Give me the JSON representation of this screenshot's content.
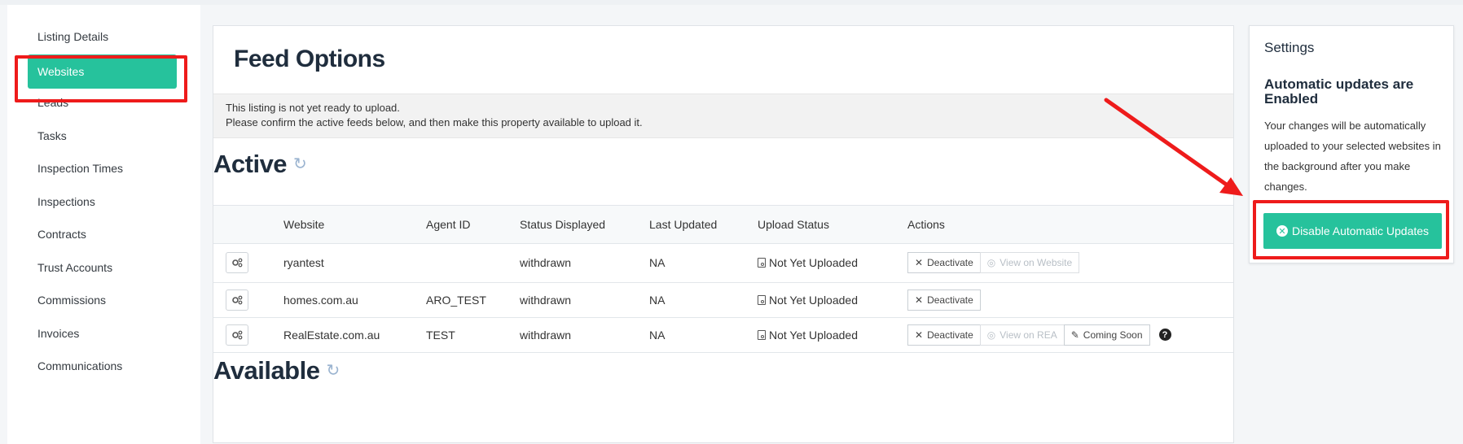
{
  "sidebar": {
    "items": [
      {
        "label": "Listing Details"
      },
      {
        "label": "Websites"
      },
      {
        "label": "Leads"
      },
      {
        "label": "Tasks"
      },
      {
        "label": "Inspection Times"
      },
      {
        "label": "Inspections"
      },
      {
        "label": "Contracts"
      },
      {
        "label": "Trust Accounts"
      },
      {
        "label": "Commissions"
      },
      {
        "label": "Invoices"
      },
      {
        "label": "Communications"
      }
    ],
    "active": "Websites"
  },
  "main": {
    "title": "Feed Options",
    "notice_line1": "This listing is not yet ready to upload.",
    "notice_line2": "Please confirm the active feeds below, and then make this property available to upload it.",
    "active_title": "Active",
    "available_title": "Available",
    "table": {
      "headers": [
        "Website",
        "Agent ID",
        "Status Displayed",
        "Last Updated",
        "Upload Status",
        "Actions"
      ],
      "rows": [
        {
          "website": "ryantest",
          "agent_id": "",
          "status": "withdrawn",
          "last_updated": "NA",
          "upload_status": "Not Yet Uploaded",
          "actions": {
            "deactivate": "Deactivate",
            "view": "View on Website"
          }
        },
        {
          "website": "homes.com.au",
          "agent_id": "ARO_TEST",
          "status": "withdrawn",
          "last_updated": "NA",
          "upload_status": "Not Yet Uploaded",
          "actions": {
            "deactivate": "Deactivate"
          }
        },
        {
          "website": "RealEstate.com.au",
          "agent_id": "TEST",
          "status": "withdrawn",
          "last_updated": "NA",
          "upload_status": "Not Yet Uploaded",
          "actions": {
            "deactivate": "Deactivate",
            "view": "View on REA",
            "coming": "Coming Soon",
            "help": "?"
          }
        }
      ]
    }
  },
  "settings": {
    "title": "Settings",
    "subtitle": "Automatic updates are Enabled",
    "description": "Your changes will be automatically uploaded to your selected websites in the background after you make changes.",
    "button_label": "Disable Automatic Updates"
  },
  "colors": {
    "accent": "#26c29c",
    "highlight": "#ee1b1b"
  }
}
